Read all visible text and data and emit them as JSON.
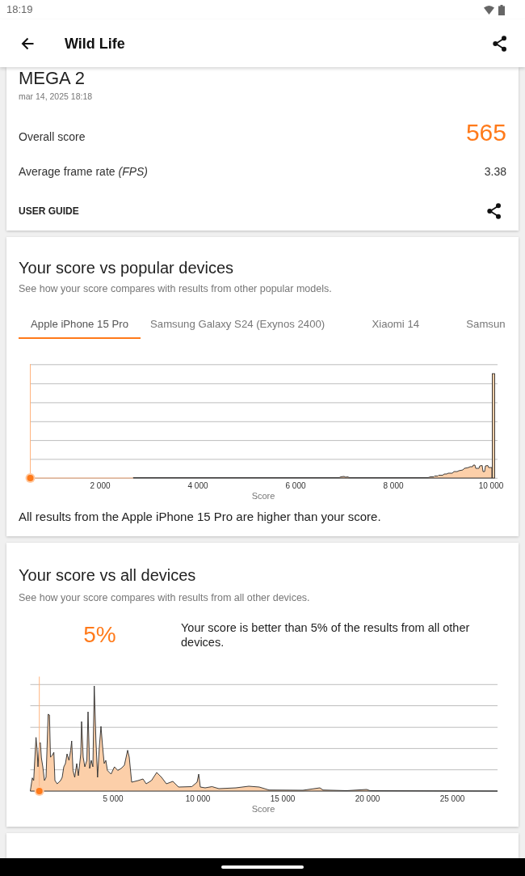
{
  "status_bar": {
    "time": "18:19"
  },
  "app_bar": {
    "title": "Wild Life"
  },
  "result": {
    "device": "MEGA 2",
    "date": "mar 14, 2025 18:18",
    "metrics": [
      {
        "kind": "score",
        "label": "Overall score",
        "value": "565"
      },
      {
        "kind": "plain",
        "label": "Average frame rate *(FPS)*",
        "value": "3.38"
      }
    ],
    "user_guide": "USER GUIDE"
  },
  "popular": {
    "title": "Your score vs popular devices",
    "subtitle": "See how your score compares with results from other popular models.",
    "tabs": [
      {
        "label": "Apple iPhone 15 Pro",
        "selected": true
      },
      {
        "label": "Samsung Galaxy S24 (Exynos 2400)",
        "selected": false
      },
      {
        "label": "Xiaomi 14",
        "selected": false
      },
      {
        "label": "Samsun",
        "selected": false
      }
    ],
    "chart": {
      "x_tick_labels": [
        "2 000",
        "4 000",
        "6 000",
        "8 000",
        "10 000"
      ],
      "x_axis_label": "Score"
    },
    "summary": "All results from the Apple iPhone 15 Pro are higher than your score."
  },
  "all_devices": {
    "title": "Your score vs all devices",
    "subtitle": "See how your score compares with results from all other devices.",
    "percentile": "5%",
    "summary": "Your score is better than 5% of the results from all other devices.",
    "chart": {
      "x_tick_labels": [
        "5 000",
        "10 000",
        "15 000",
        "20 000",
        "25 000"
      ],
      "x_axis_label": "Score"
    }
  }
}
